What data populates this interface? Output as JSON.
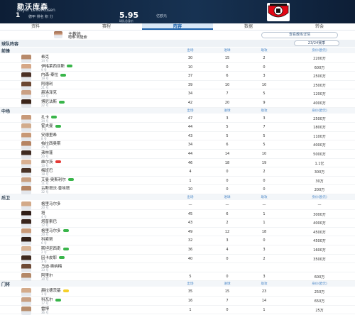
{
  "header": {
    "team_cn": "勒沃库森",
    "team_en": "Bayer Leverkusen",
    "rank": "1",
    "rank_sub": "德甲 排名  积 分",
    "value": "5.95",
    "value_unit": "亿欧元",
    "value_sub": "球队总身价"
  },
  "tabs": [
    {
      "label": "资料",
      "active": false
    },
    {
      "label": "赛程",
      "active": false
    },
    {
      "label": "阵容",
      "active": true
    },
    {
      "label": "数据",
      "active": false
    },
    {
      "label": "转会",
      "active": false
    }
  ],
  "coach": {
    "label": "主教练",
    "name": "哈维·阿隆索",
    "link": "查看教练详情"
  },
  "squad": {
    "title": "球队阵容",
    "season": "23/24赛季"
  },
  "columns": [
    "出场",
    "进球",
    "助攻",
    "身价(欧元)"
  ],
  "sections": [
    {
      "label": "前锋",
      "players": [
        {
          "name": "希克",
          "num": "14 号",
          "icon": "",
          "stats": [
            "30",
            "15",
            "2",
            "2200万"
          ],
          "skin": "#b88a6b"
        },
        {
          "name": "伊格莱西亚斯",
          "num": "9 号",
          "icon": "green",
          "stats": [
            "10",
            "0",
            "0",
            "600万"
          ],
          "skin": "#d6a787"
        },
        {
          "name": "内森-泰拉",
          "num": "19 号",
          "icon": "green",
          "stats": [
            "37",
            "6",
            "3",
            "2500万"
          ],
          "skin": "#4a2f24"
        },
        {
          "name": "阿德利",
          "num": "21 号",
          "icon": "",
          "stats": [
            "39",
            "10",
            "10",
            "2500万"
          ],
          "skin": "#6b4631"
        },
        {
          "name": "赫洛泽克",
          "num": "23 号",
          "icon": "",
          "stats": [
            "34",
            "7",
            "5",
            "1200万"
          ],
          "skin": "#caa084"
        },
        {
          "name": "博尼法斯",
          "num": "22 号",
          "icon": "green",
          "stats": [
            "42",
            "20",
            "9",
            "4000万"
          ],
          "skin": "#3b2419"
        }
      ]
    },
    {
      "label": "中场",
      "players": [
        {
          "name": "扎卡",
          "num": "34 号",
          "icon": "green",
          "stats": [
            "47",
            "3",
            "3",
            "2500万"
          ],
          "skin": "#c89a7a"
        },
        {
          "name": "霍夫曼",
          "num": "7 号",
          "icon": "green",
          "stats": [
            "44",
            "5",
            "7",
            "1800万"
          ],
          "skin": "#d2ab8c"
        },
        {
          "name": "安德里希",
          "num": "8 号",
          "icon": "",
          "stats": [
            "43",
            "5",
            "5",
            "1100万"
          ],
          "skin": "#c89876"
        },
        {
          "name": "帕拉西奥斯",
          "num": "25 号",
          "icon": "",
          "stats": [
            "34",
            "6",
            "5",
            "4000万"
          ],
          "skin": "#b68463"
        },
        {
          "name": "弗林蓬",
          "num": "20 号",
          "icon": "",
          "stats": [
            "44",
            "14",
            "10",
            "5000万"
          ],
          "skin": "#3f2a20"
        },
        {
          "name": "维尔茨",
          "num": "10 号",
          "icon": "red",
          "stats": [
            "46",
            "18",
            "19",
            "1.1亿"
          ],
          "skin": "#d8b092"
        },
        {
          "name": "梅班巴",
          "num": "18 号",
          "icon": "",
          "stats": [
            "4",
            "0",
            "2",
            "300万"
          ],
          "skin": "#4b3428"
        },
        {
          "name": "艾曼·奥斯利尔",
          "num": "11 号",
          "icon": "green",
          "stats": [
            "1",
            "0",
            "0",
            "30万"
          ],
          "skin": "#c9a082"
        },
        {
          "name": "古斯塔沃·普埃塔",
          "num": "32 号",
          "icon": "",
          "stats": [
            "10",
            "0",
            "0",
            "200万"
          ],
          "skin": "#b58564"
        }
      ]
    },
    {
      "label": "后卫",
      "players": [
        {
          "name": "格里马尔多",
          "num": "20 号",
          "icon": "",
          "stats": [
            "—",
            "—",
            "—",
            "—"
          ],
          "skin": "#d3a988"
        },
        {
          "name": "塔",
          "num": "4 号",
          "icon": "",
          "stats": [
            "45",
            "6",
            "1",
            "3000万"
          ],
          "skin": "#2f1d16"
        },
        {
          "name": "塔普索巴",
          "num": "12 号",
          "icon": "",
          "stats": [
            "43",
            "2",
            "1",
            "4000万"
          ],
          "skin": "#3a251c"
        },
        {
          "name": "格里马尔多",
          "num": "20 号",
          "icon": "green",
          "stats": [
            "49",
            "12",
            "18",
            "4500万"
          ],
          "skin": "#c99a78"
        },
        {
          "name": "科索努",
          "num": "6 号",
          "icon": "",
          "stats": [
            "32",
            "3",
            "0",
            "4500万"
          ],
          "skin": "#322018"
        },
        {
          "name": "斯坦尼西奇",
          "num": "2 号",
          "icon": "green",
          "stats": [
            "36",
            "4",
            "3",
            "1600万"
          ],
          "skin": "#d8b394"
        },
        {
          "name": "因卡皮耶",
          "num": "3 号",
          "icon": "green",
          "stats": [
            "40",
            "0",
            "2",
            "3500万"
          ],
          "skin": "#3f2a1f"
        },
        {
          "name": "马迪·奥纳梅",
          "num": "33 号",
          "icon": "",
          "stats": [
            "",
            "",
            "",
            ""
          ],
          "skin": "#6e4a36"
        },
        {
          "name": "阿里尔",
          "num": "30 号",
          "icon": "",
          "stats": [
            "5",
            "0",
            "3",
            "600万"
          ],
          "skin": "#b48868"
        }
      ]
    },
    {
      "label": "门将",
      "players": [
        {
          "name": "赫拉德茨基",
          "num": "1 号",
          "icon": "yellow",
          "stats": [
            "35",
            "15",
            "23",
            "250万"
          ],
          "skin": "#d4ab8b"
        },
        {
          "name": "科瓦尔",
          "num": "17 号",
          "icon": "green",
          "stats": [
            "16",
            "7",
            "14",
            "650万"
          ],
          "skin": "#c9a083"
        },
        {
          "name": "雷博",
          "num": "36 号",
          "icon": "",
          "stats": [
            "1",
            "0",
            "1",
            "25万"
          ],
          "skin": "#b88d6c"
        }
      ]
    }
  ]
}
